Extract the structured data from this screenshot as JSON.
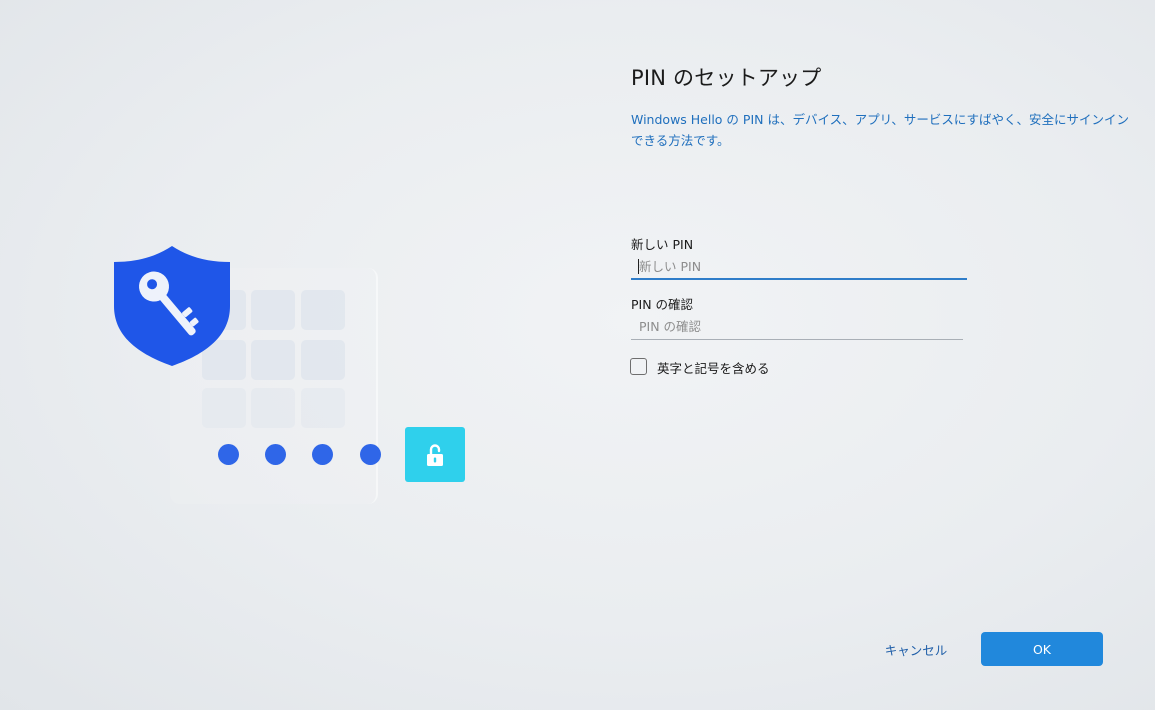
{
  "page": {
    "title": "PIN のセットアップ",
    "description": "Windows Hello の PIN は、デバイス、アプリ、サービスにすばやく、安全にサインインできる方法です。"
  },
  "form": {
    "new_pin_label": "新しい PIN",
    "new_pin_placeholder": "新しい PIN",
    "confirm_pin_label": "PIN の確認",
    "confirm_pin_placeholder": "PIN の確認",
    "include_letters_label": "英字と記号を含める",
    "include_letters_checked": false
  },
  "buttons": {
    "cancel": "キャンセル",
    "ok": "OK"
  },
  "illustration": {
    "icons": [
      "shield-key-icon",
      "unlock-icon"
    ],
    "pin_dots": 4
  },
  "colors": {
    "accent": "#2188dc",
    "link_text": "#1f6fbd",
    "shield": "#1f56e8",
    "dots": "#2f66e8",
    "unlock_tile": "#2fd0ec"
  }
}
